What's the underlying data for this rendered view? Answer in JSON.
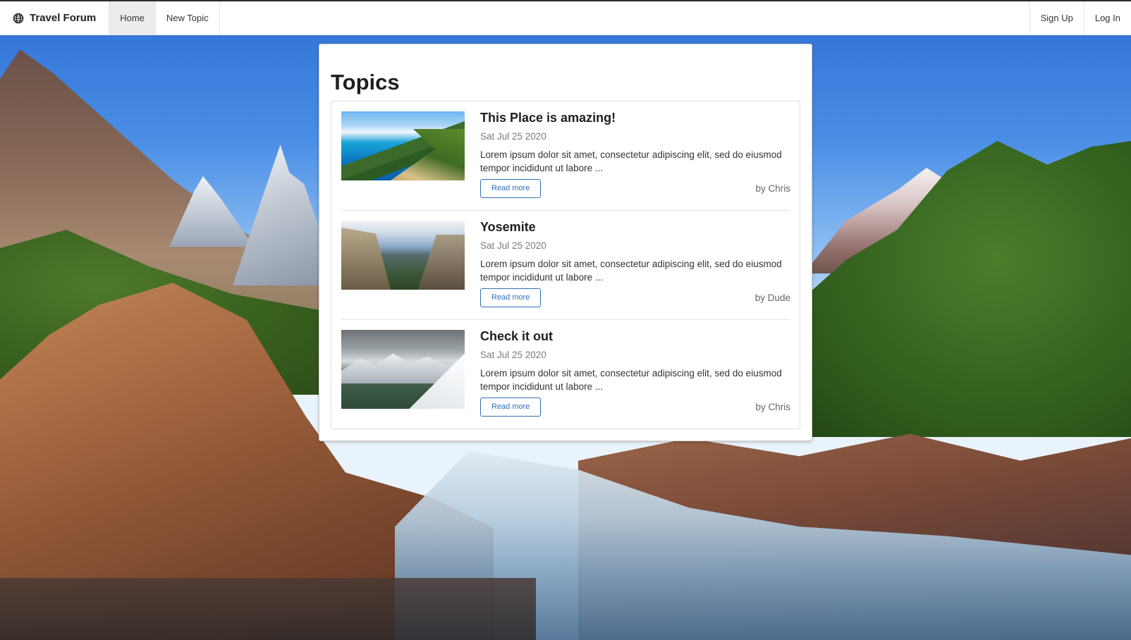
{
  "app": {
    "brand": "Travel Forum",
    "brand_icon": "globe-icon"
  },
  "nav": {
    "left": [
      {
        "label": "Home",
        "active": true
      },
      {
        "label": "New Topic",
        "active": false
      }
    ],
    "right": [
      {
        "label": "Sign Up"
      },
      {
        "label": "Log In"
      }
    ]
  },
  "main": {
    "title": "Topics",
    "read_more_label": "Read more",
    "topics": [
      {
        "title": "This Place is amazing!",
        "date": "Sat Jul 25 2020",
        "excerpt": "Lorem ipsum dolor sit amet, consectetur adipiscing elit, sed do eiusmod tempor incididunt ut labore ...",
        "author": "by Chris"
      },
      {
        "title": "Yosemite",
        "date": "Sat Jul 25 2020",
        "excerpt": "Lorem ipsum dolor sit amet, consectetur adipiscing elit, sed do eiusmod tempor incididunt ut labore ...",
        "author": "by Dude"
      },
      {
        "title": "Check it out",
        "date": "Sat Jul 25 2020",
        "excerpt": "Lorem ipsum dolor sit amet, consectetur adipiscing elit, sed do eiusmod tempor incididunt ut labore ...",
        "author": "by Chris"
      }
    ]
  },
  "colors": {
    "accent": "#2f6fb6",
    "navbar_bg": "#ffffff",
    "active_nav_bg": "#ececec"
  }
}
